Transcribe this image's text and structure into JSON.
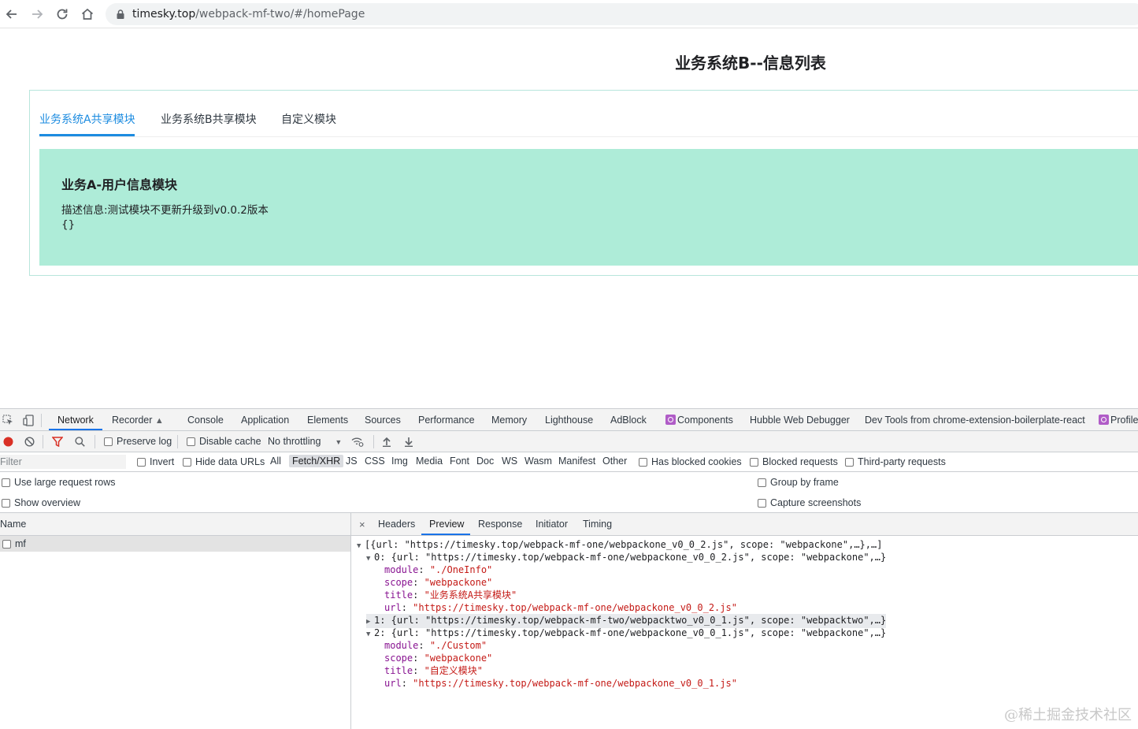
{
  "browser": {
    "url_host": "timesky.top",
    "url_path": "/webpack-mf-two/#/homePage"
  },
  "page": {
    "heading": "业务系统B--信息列表",
    "tabs": [
      "业务系统A共享模块",
      "业务系统B共享模块",
      "自定义模块"
    ],
    "active_tab_index": 0,
    "module_title": "业务A-用户信息模块",
    "module_desc": "描述信息:测试模块不更新升级到v0.0.2版本",
    "module_obj": "{}",
    "panel_color": "#aeecd8",
    "accent_color": "#1d8ce0"
  },
  "devtools": {
    "tabs": {
      "network": "Network",
      "recorder": "Recorder",
      "console": "Console",
      "application": "Application",
      "elements": "Elements",
      "sources": "Sources",
      "performance": "Performance",
      "memory": "Memory",
      "lighthouse": "Lighthouse",
      "adblock": "AdBlock",
      "components": "Components",
      "hubble": "Hubble Web Debugger",
      "devtools_ext": "Dev Tools from chrome-extension-boilerplate-react",
      "profiler": "Profiler"
    },
    "toolbar": {
      "preserve_log": "Preserve log",
      "disable_cache": "Disable cache",
      "throttling": "No throttling"
    },
    "filter": {
      "placeholder": "Filter",
      "invert": "Invert",
      "hide_data_urls": "Hide data URLs",
      "types": [
        "All",
        "Fetch/XHR",
        "JS",
        "CSS",
        "Img",
        "Media",
        "Font",
        "Doc",
        "WS",
        "Wasm",
        "Manifest",
        "Other"
      ],
      "active_type": "Fetch/XHR",
      "has_blocked_cookies": "Has blocked cookies",
      "blocked_requests": "Blocked requests",
      "third_party": "Third-party requests"
    },
    "options": {
      "large_rows": "Use large request rows",
      "show_overview": "Show overview",
      "group_by_frame": "Group by frame",
      "capture_screenshots": "Capture screenshots"
    },
    "request_list": {
      "header": "Name",
      "rows": [
        "mf"
      ]
    },
    "detail_tabs": {
      "close": "×",
      "headers": "Headers",
      "preview": "Preview",
      "response": "Response",
      "initiator": "Initiator",
      "timing": "Timing"
    },
    "preview": {
      "root": "[{url: \"https://timesky.top/webpack-mf-one/webpackone_v0_0_2.js\", scope: \"webpackone\",…},…]",
      "item0": "0: {url: \"https://timesky.top/webpack-mf-one/webpackone_v0_0_2.js\", scope: \"webpackone\",…}",
      "item0_module_key": "module",
      "item0_module_val": "\"./OneInfo\"",
      "item0_scope_key": "scope",
      "item0_scope_val": "\"webpackone\"",
      "item0_title_key": "title",
      "item0_title_val": "\"业务系统A共享模块\"",
      "item0_url_key": "url",
      "item0_url_val": "\"https://timesky.top/webpack-mf-one/webpackone_v0_0_2.js\"",
      "item1": "1: {url: \"https://timesky.top/webpack-mf-two/webpacktwo_v0_0_1.js\", scope: \"webpacktwo\",…}",
      "item2": "2: {url: \"https://timesky.top/webpack-mf-one/webpackone_v0_0_1.js\", scope: \"webpackone\",…}",
      "item2_module_key": "module",
      "item2_module_val": "\"./Custom\"",
      "item2_scope_key": "scope",
      "item2_scope_val": "\"webpackone\"",
      "item2_title_key": "title",
      "item2_title_val": "\"自定义模块\"",
      "item2_url_key": "url",
      "item2_url_val": "\"https://timesky.top/webpack-mf-one/webpackone_v0_0_1.js\""
    },
    "watermark": "@稀土掘金技术社区"
  }
}
